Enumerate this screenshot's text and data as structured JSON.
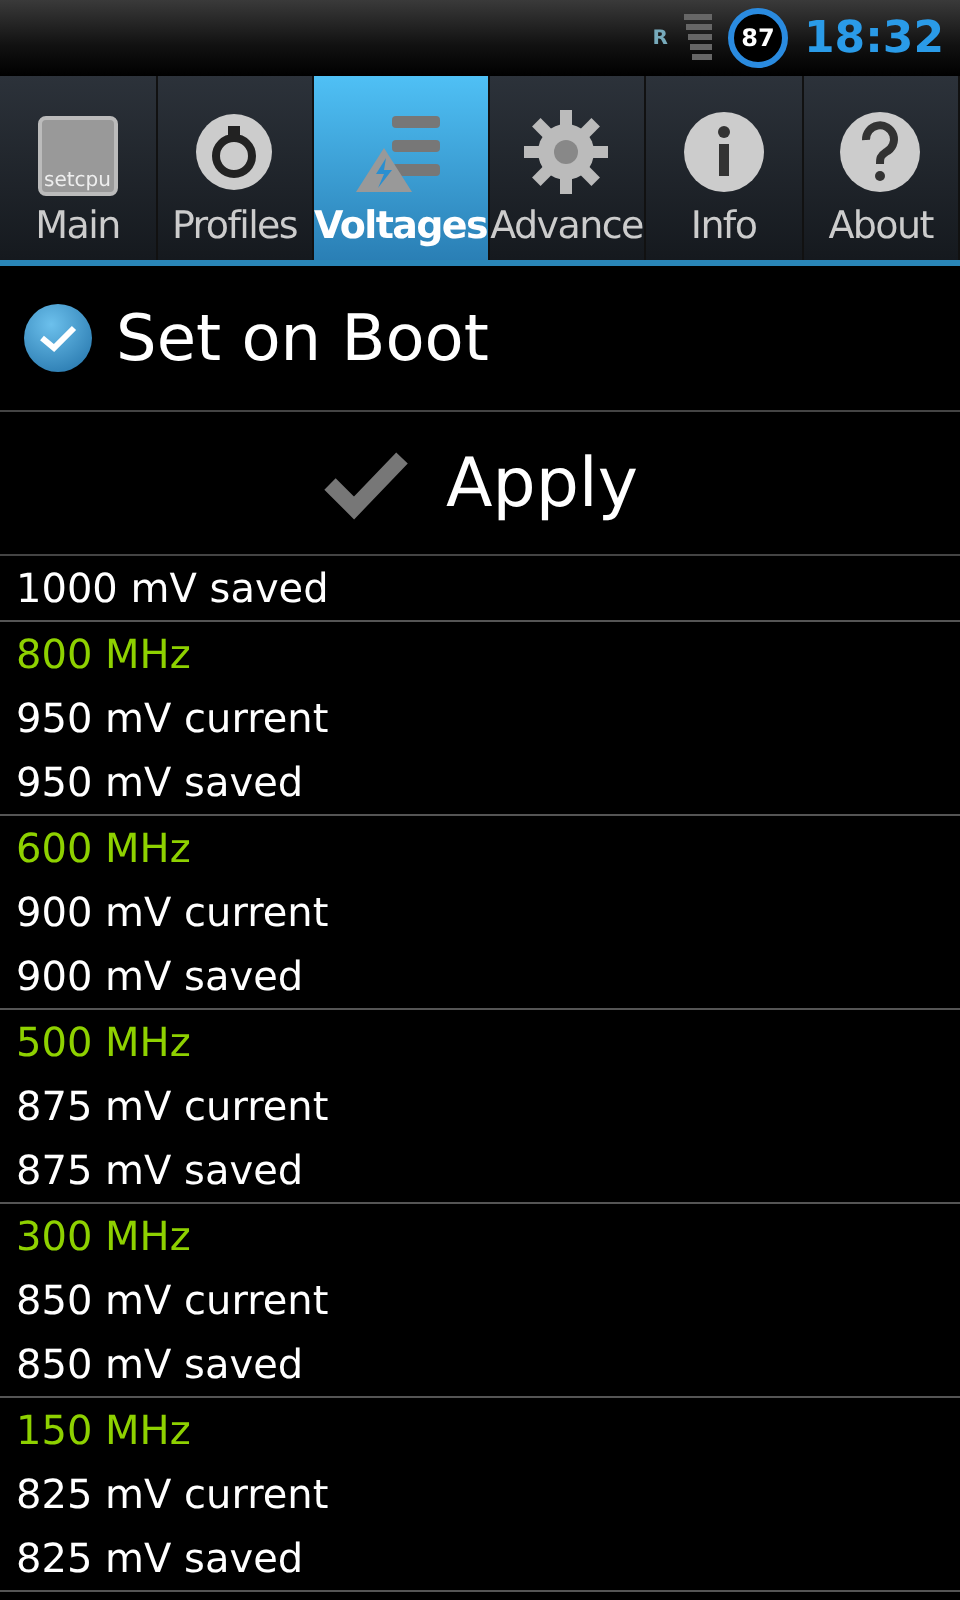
{
  "status_bar": {
    "network": "R",
    "battery": "87",
    "time": "18:32"
  },
  "tabs": [
    {
      "label": "Main",
      "kind": "setcpu",
      "icon_text": "setcpu",
      "selected": false
    },
    {
      "label": "Profiles",
      "kind": "profiles",
      "selected": false
    },
    {
      "label": "Voltages",
      "kind": "voltages",
      "selected": true
    },
    {
      "label": "Advance",
      "kind": "gear",
      "selected": false
    },
    {
      "label": "Info",
      "kind": "info",
      "selected": false
    },
    {
      "label": "About",
      "kind": "help",
      "selected": false
    }
  ],
  "set_on_boot": {
    "label": "Set on Boot",
    "checked": true
  },
  "apply_button": {
    "label": "Apply"
  },
  "voltage_groups": [
    {
      "lines": [
        "1000 mV saved"
      ]
    },
    {
      "frequency": "800 MHz",
      "lines": [
        "950 mV current",
        "950 mV saved"
      ]
    },
    {
      "frequency": "600 MHz",
      "lines": [
        "900 mV current",
        "900 mV saved"
      ]
    },
    {
      "frequency": "500 MHz",
      "lines": [
        "875 mV current",
        "875 mV saved"
      ]
    },
    {
      "frequency": "300 MHz",
      "lines": [
        "850 mV current",
        "850 mV saved"
      ]
    },
    {
      "frequency": "150 MHz",
      "lines": [
        "825 mV current",
        "825 mV saved"
      ]
    }
  ]
}
